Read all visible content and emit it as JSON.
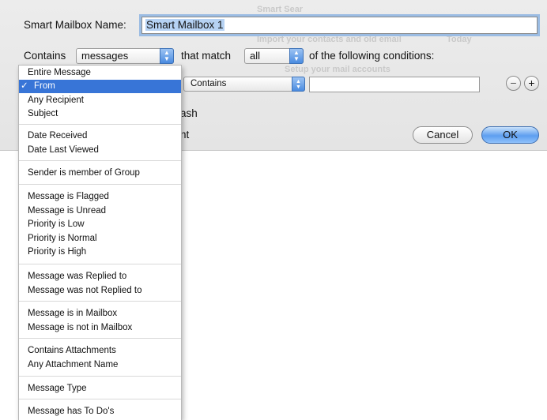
{
  "dialog": {
    "name_label": "Smart Mailbox Name:",
    "name_value": "Smart Mailbox 1",
    "contains_label": "Contains",
    "contains_value": "messages",
    "match_label": "that match",
    "match_value": "all",
    "conditions_label": "of the following conditions:",
    "condition_operator": "Contains",
    "condition_value": "",
    "remove_label": "−",
    "add_label": "+",
    "trash_fragment": "ash",
    "sent_fragment": "nt",
    "cancel_label": "Cancel",
    "ok_label": "OK"
  },
  "background": {
    "ghost_items": [
      "Smart Sear",
      "Import your contacts and old email",
      "Today",
      "Setup your mail accounts"
    ]
  },
  "menu": {
    "items": [
      "Entire Message",
      "From",
      "Any Recipient",
      "Subject",
      "Date Received",
      "Date Last Viewed",
      "Sender is member of Group",
      "Message is Flagged",
      "Message is Unread",
      "Priority is Low",
      "Priority is Normal",
      "Priority is High",
      "Message was Replied to",
      "Message was not Replied to",
      "Message is in Mailbox",
      "Message is not in Mailbox",
      "Contains Attachments",
      "Any Attachment Name",
      "Message Type",
      "Message has To Do's"
    ],
    "selected": "From",
    "check": "✓"
  },
  "colors": {
    "highlight": "#3875d7",
    "focus_ring": "#9bbce3"
  }
}
